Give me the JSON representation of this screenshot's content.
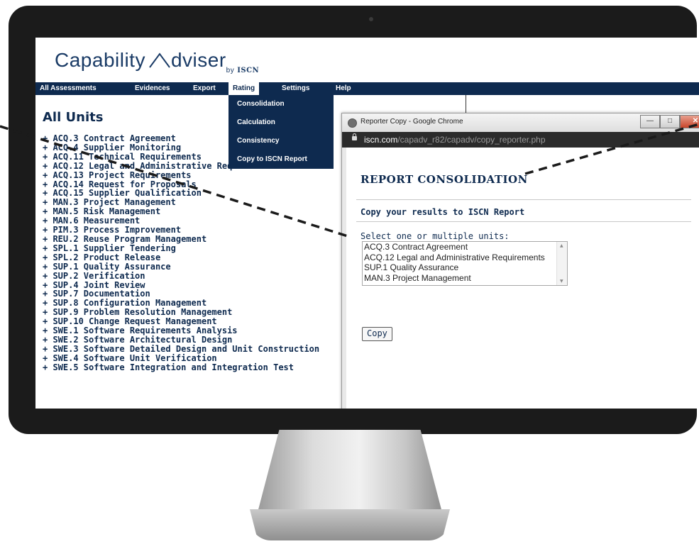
{
  "app": {
    "logo_main": "Capability",
    "logo_second": "dviser",
    "logo_by": "by",
    "logo_org": "ISCN"
  },
  "menu": {
    "items": [
      {
        "label": "All Assessments"
      },
      {
        "label": "Evidences"
      },
      {
        "label": "Export"
      },
      {
        "label": "Rating"
      },
      {
        "label": "Settings"
      },
      {
        "label": "Help"
      }
    ],
    "rating_dropdown": [
      {
        "label": "Consolidation"
      },
      {
        "label": "Calculation"
      },
      {
        "label": "Consistency"
      },
      {
        "label": "Copy to ISCN Report"
      }
    ]
  },
  "units": {
    "title": "All Units",
    "items": [
      "+ ACQ.3 Contract Agreement",
      "+ ACQ.4 Supplier Monitoring",
      "+ ACQ.11 Technical Requirements",
      "+ ACQ.12 Legal and Administrative Requirements",
      "+ ACQ.13 Project Requirements",
      "+ ACQ.14 Request for Proposals",
      "+ ACQ.15 Supplier Qualification",
      "+ MAN.3 Project Management",
      "+ MAN.5 Risk Management",
      "+ MAN.6 Measurement",
      "+ PIM.3 Process Improvement",
      "+ REU.2 Reuse Program Management",
      "+ SPL.1 Supplier Tendering",
      "+ SPL.2 Product Release",
      "+ SUP.1 Quality Assurance",
      "+ SUP.2 Verification",
      "+ SUP.4 Joint Review",
      "+ SUP.7 Documentation",
      "+ SUP.8 Configuration Management",
      "+ SUP.9 Problem Resolution Management",
      "+ SUP.10 Change Request Management",
      "+ SWE.1 Software Requirements Analysis",
      "+ SWE.2 Software Architectural Design",
      "+ SWE.3 Software Detailed Design and Unit Construction",
      "+ SWE.4 Software Unit Verification",
      "+ SWE.5 Software Integration and Integration Test"
    ]
  },
  "popup": {
    "window_title": "Reporter Copy - Google Chrome",
    "url_domain": "iscn.com",
    "url_path": "/capadv_r82/capadv/copy_reporter.php",
    "heading": "REPORT CONSOLIDATION",
    "section_title": "Copy your results to ISCN Report",
    "select_label": "Select one or multiple units:",
    "options": [
      "ACQ.3 Contract Agreement",
      "ACQ.12 Legal and Administrative Requirements",
      "SUP.1 Quality Assurance",
      "MAN.3 Project Management"
    ],
    "copy_label": "Copy"
  },
  "colors": {
    "brand_navy": "#0e2a4f",
    "monitor_bezel": "#1b1b1b"
  }
}
